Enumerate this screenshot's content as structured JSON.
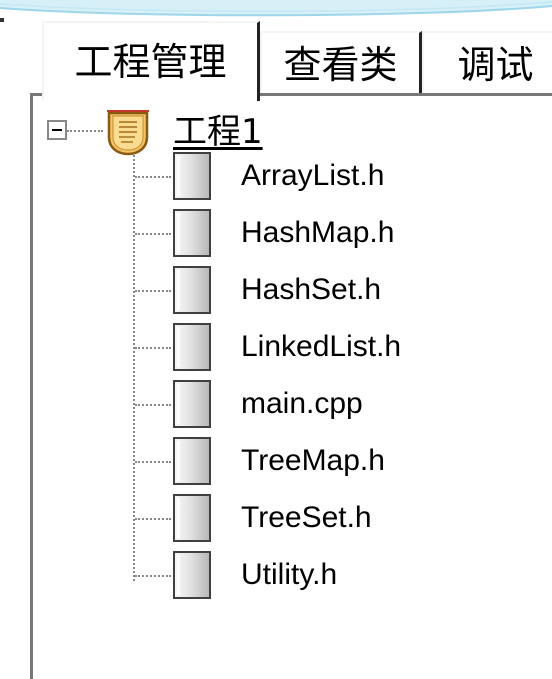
{
  "tabs": [
    {
      "label": "工程管理",
      "active": true
    },
    {
      "label": "查看类",
      "active": false
    },
    {
      "label": "调试",
      "active": false
    }
  ],
  "tree": {
    "root": {
      "label": "工程1",
      "expanded": true,
      "icon": "project-folder-icon"
    },
    "files": [
      {
        "label": "ArrayList.h",
        "icon": "file-icon"
      },
      {
        "label": "HashMap.h",
        "icon": "file-icon"
      },
      {
        "label": "HashSet.h",
        "icon": "file-icon"
      },
      {
        "label": "LinkedList.h",
        "icon": "file-icon"
      },
      {
        "label": "main.cpp",
        "icon": "file-icon"
      },
      {
        "label": "TreeMap.h",
        "icon": "file-icon"
      },
      {
        "label": "TreeSet.h",
        "icon": "file-icon"
      },
      {
        "label": "Utility.h",
        "icon": "file-icon"
      }
    ]
  },
  "colors": {
    "banner": "#bfe6f3",
    "root_icon_fill": "#f2c56a",
    "root_icon_outline": "#8a5a10"
  }
}
